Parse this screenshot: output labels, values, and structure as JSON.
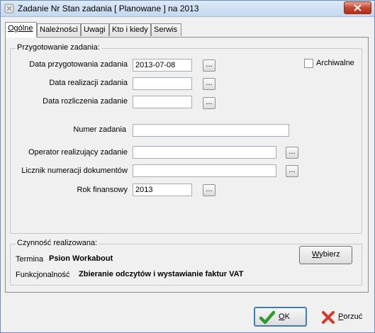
{
  "window": {
    "title": "Zadanie Nr  Stan zadania [ Planowane ] na 2013"
  },
  "tabs": [
    {
      "label": "Ogólne",
      "active": true
    },
    {
      "label": "Należności",
      "active": false
    },
    {
      "label": "Uwagi",
      "active": false
    },
    {
      "label": "Kto i kiedy",
      "active": false
    },
    {
      "label": "Serwis",
      "active": false
    }
  ],
  "preparation": {
    "legend": "Przygotowanie zadania:",
    "archive_label": "Archiwalne",
    "archive_checked": false,
    "prep_date_label": "Data przygotowania zadania",
    "prep_date_value": "2013-07-08",
    "realization_date_label": "Data realizacji zadania",
    "realization_date_value": "",
    "settlement_date_label": "Data rozliczenia zadanie",
    "settlement_date_value": "",
    "task_number_label": "Numer zadania",
    "task_number_value": "",
    "operator_label": "Operator realizujący zadanie",
    "operator_value": "",
    "doc_counter_label": "Licznik numeracji dokumentów",
    "doc_counter_value": "",
    "fiscal_year_label": "Rok finansowy",
    "fiscal_year_value": "2013",
    "browse_label": "..."
  },
  "activity": {
    "legend": "Czynność realizowana:",
    "terminal_label": "Termina",
    "terminal_value": "Psion Workabout",
    "function_label": "Funkcjonalność",
    "function_value": "Zbieranie odczytów i wystawianie faktur VAT",
    "choose_button_mnemonic": "W",
    "choose_button_rest": "ybierz"
  },
  "buttons": {
    "ok_mnemonic": "O",
    "ok_rest": "K",
    "cancel_mnemonic": "P",
    "cancel_rest": "orzuć"
  },
  "colors": {
    "ok_check": "#2f9a2f",
    "cancel_x": "#d9342b",
    "close_button": "#c4472e"
  }
}
